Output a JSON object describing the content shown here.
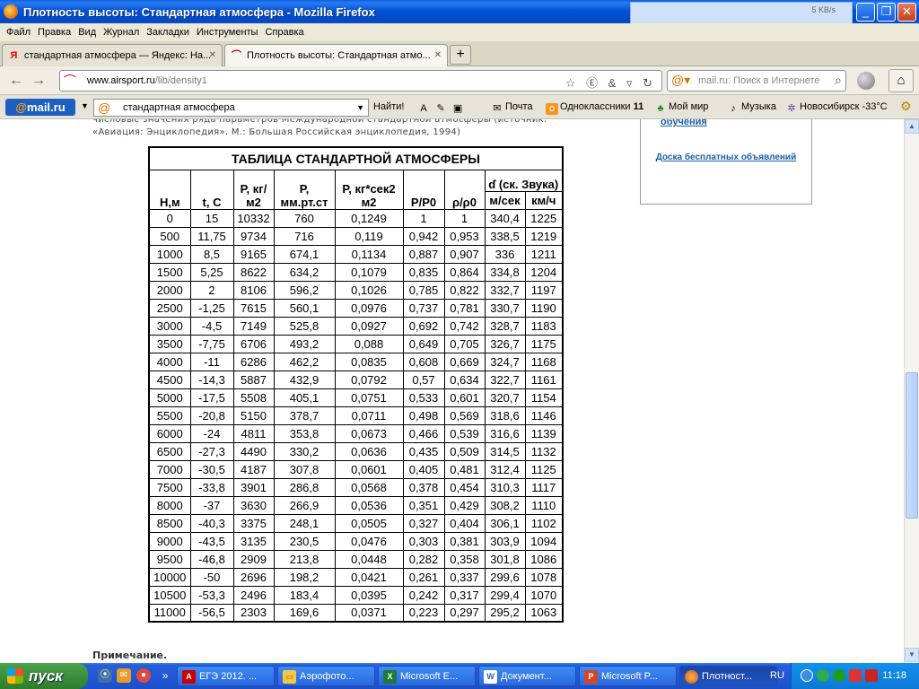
{
  "window": {
    "title": "Плотность высоты: Стандартная атмосфера - Mozilla Firefox",
    "download_speed": "5 KB/s"
  },
  "menu": [
    "Файл",
    "Правка",
    "Вид",
    "Журнал",
    "Закладки",
    "Инструменты",
    "Справка"
  ],
  "tabs": [
    {
      "label": "стандартная атмосфера — Яндекс: На...",
      "icon": "yandex-icon",
      "active": false
    },
    {
      "label": "Плотность высоты: Стандартная атмо...",
      "icon": "airsport-icon",
      "active": true
    }
  ],
  "nav": {
    "url_domain": "www.airsport.ru",
    "url_path": "/lib/density1",
    "search_placeholder": "mail.ru: Поиск в Интернете"
  },
  "mailbar": {
    "logo_at": "@",
    "logo_text": "mail.ru",
    "search_value": "стандартная атмосфера",
    "find_label": "Найти!",
    "mail_label": "Почта",
    "ok_label": "Одноклассники",
    "ok_count": "11",
    "myworld_label": "Мой мир",
    "music_label": "Музыка",
    "weather_label": "Новосибирск -33°C"
  },
  "page": {
    "intro_line1": "числовые значения ряда параметров Международной стандартной атмосферы (источник:",
    "intro_line2": "«Авиация: Энциклопедия». М.: Большая Российская энциклопедия, 1994)",
    "side_link1": "обучения",
    "side_link2": "Доска бесплатных объявлений",
    "note": "Примечание."
  },
  "table": {
    "title": "ТАБЛИЦА СТАНДАРТНОЙ АТМОСФЕРЫ",
    "headers": {
      "h": "Н,м",
      "t": "t, C",
      "p_kg": "Р, кг/м2",
      "p_mm": "Р, мм.рт.ст",
      "rho": "Р, кг*сек2 м2",
      "p_ratio": "Р/Р0",
      "rho_ratio": "ρ/ρ0",
      "sound": "ɗ (ск. Звука)",
      "sound_ms": "м/сек",
      "sound_kmh": "км/ч"
    },
    "rows": [
      [
        "0",
        "15",
        "10332",
        "760",
        "0,1249",
        "1",
        "1",
        "340,4",
        "1225"
      ],
      [
        "500",
        "11,75",
        "9734",
        "716",
        "0,119",
        "0,942",
        "0,953",
        "338,5",
        "1219"
      ],
      [
        "1000",
        "8,5",
        "9165",
        "674,1",
        "0,1134",
        "0,887",
        "0,907",
        "336",
        "1211"
      ],
      [
        "1500",
        "5,25",
        "8622",
        "634,2",
        "0,1079",
        "0,835",
        "0,864",
        "334,8",
        "1204"
      ],
      [
        "2000",
        "2",
        "8106",
        "596,2",
        "0,1026",
        "0,785",
        "0,822",
        "332,7",
        "1197"
      ],
      [
        "2500",
        "-1,25",
        "7615",
        "560,1",
        "0,0976",
        "0,737",
        "0,781",
        "330,7",
        "1190"
      ],
      [
        "3000",
        "-4,5",
        "7149",
        "525,8",
        "0,0927",
        "0,692",
        "0,742",
        "328,7",
        "1183"
      ],
      [
        "3500",
        "-7,75",
        "6706",
        "493,2",
        "0,088",
        "0,649",
        "0,705",
        "326,7",
        "1175"
      ],
      [
        "4000",
        "-11",
        "6286",
        "462,2",
        "0,0835",
        "0,608",
        "0,669",
        "324,7",
        "1168"
      ],
      [
        "4500",
        "-14,3",
        "5887",
        "432,9",
        "0,0792",
        "0,57",
        "0,634",
        "322,7",
        "1161"
      ],
      [
        "5000",
        "-17,5",
        "5508",
        "405,1",
        "0,0751",
        "0,533",
        "0,601",
        "320,7",
        "1154"
      ],
      [
        "5500",
        "-20,8",
        "5150",
        "378,7",
        "0,0711",
        "0,498",
        "0,569",
        "318,6",
        "1146"
      ],
      [
        "6000",
        "-24",
        "4811",
        "353,8",
        "0,0673",
        "0,466",
        "0,539",
        "316,6",
        "1139"
      ],
      [
        "6500",
        "-27,3",
        "4490",
        "330,2",
        "0,0636",
        "0,435",
        "0,509",
        "314,5",
        "1132"
      ],
      [
        "7000",
        "-30,5",
        "4187",
        "307,8",
        "0,0601",
        "0,405",
        "0,481",
        "312,4",
        "1125"
      ],
      [
        "7500",
        "-33,8",
        "3901",
        "286,8",
        "0,0568",
        "0,378",
        "0,454",
        "310,3",
        "1117"
      ],
      [
        "8000",
        "-37",
        "3630",
        "266,9",
        "0,0536",
        "0,351",
        "0,429",
        "308,2",
        "1110"
      ],
      [
        "8500",
        "-40,3",
        "3375",
        "248,1",
        "0,0505",
        "0,327",
        "0,404",
        "306,1",
        "1102"
      ],
      [
        "9000",
        "-43,5",
        "3135",
        "230,5",
        "0,0476",
        "0,303",
        "0,381",
        "303,9",
        "1094"
      ],
      [
        "9500",
        "-46,8",
        "2909",
        "213,8",
        "0,0448",
        "0,282",
        "0,358",
        "301,8",
        "1086"
      ],
      [
        "10000",
        "-50",
        "2696",
        "198,2",
        "0,0421",
        "0,261",
        "0,337",
        "299,6",
        "1078"
      ],
      [
        "10500",
        "-53,3",
        "2496",
        "183,4",
        "0,0395",
        "0,242",
        "0,317",
        "299,4",
        "1070"
      ],
      [
        "11000",
        "-56,5",
        "2303",
        "169,6",
        "0,0371",
        "0,223",
        "0,297",
        "295,2",
        "1063"
      ]
    ]
  },
  "taskbar": {
    "start_label": "пуск",
    "tasks": [
      {
        "label": "ЕГЭ 2012. ...",
        "icon": "pdf-icon",
        "active": false
      },
      {
        "label": "Аэрофото...",
        "icon": "folder-icon",
        "active": false
      },
      {
        "label": "Microsoft E...",
        "icon": "excel-icon",
        "active": false
      },
      {
        "label": "Документ...",
        "icon": "document-icon",
        "active": false
      },
      {
        "label": "Microsoft P...",
        "icon": "powerpoint-icon",
        "active": false
      },
      {
        "label": "Плотност...",
        "icon": "firefox-icon",
        "active": true
      }
    ],
    "lang": "RU",
    "clock": "11:18"
  }
}
